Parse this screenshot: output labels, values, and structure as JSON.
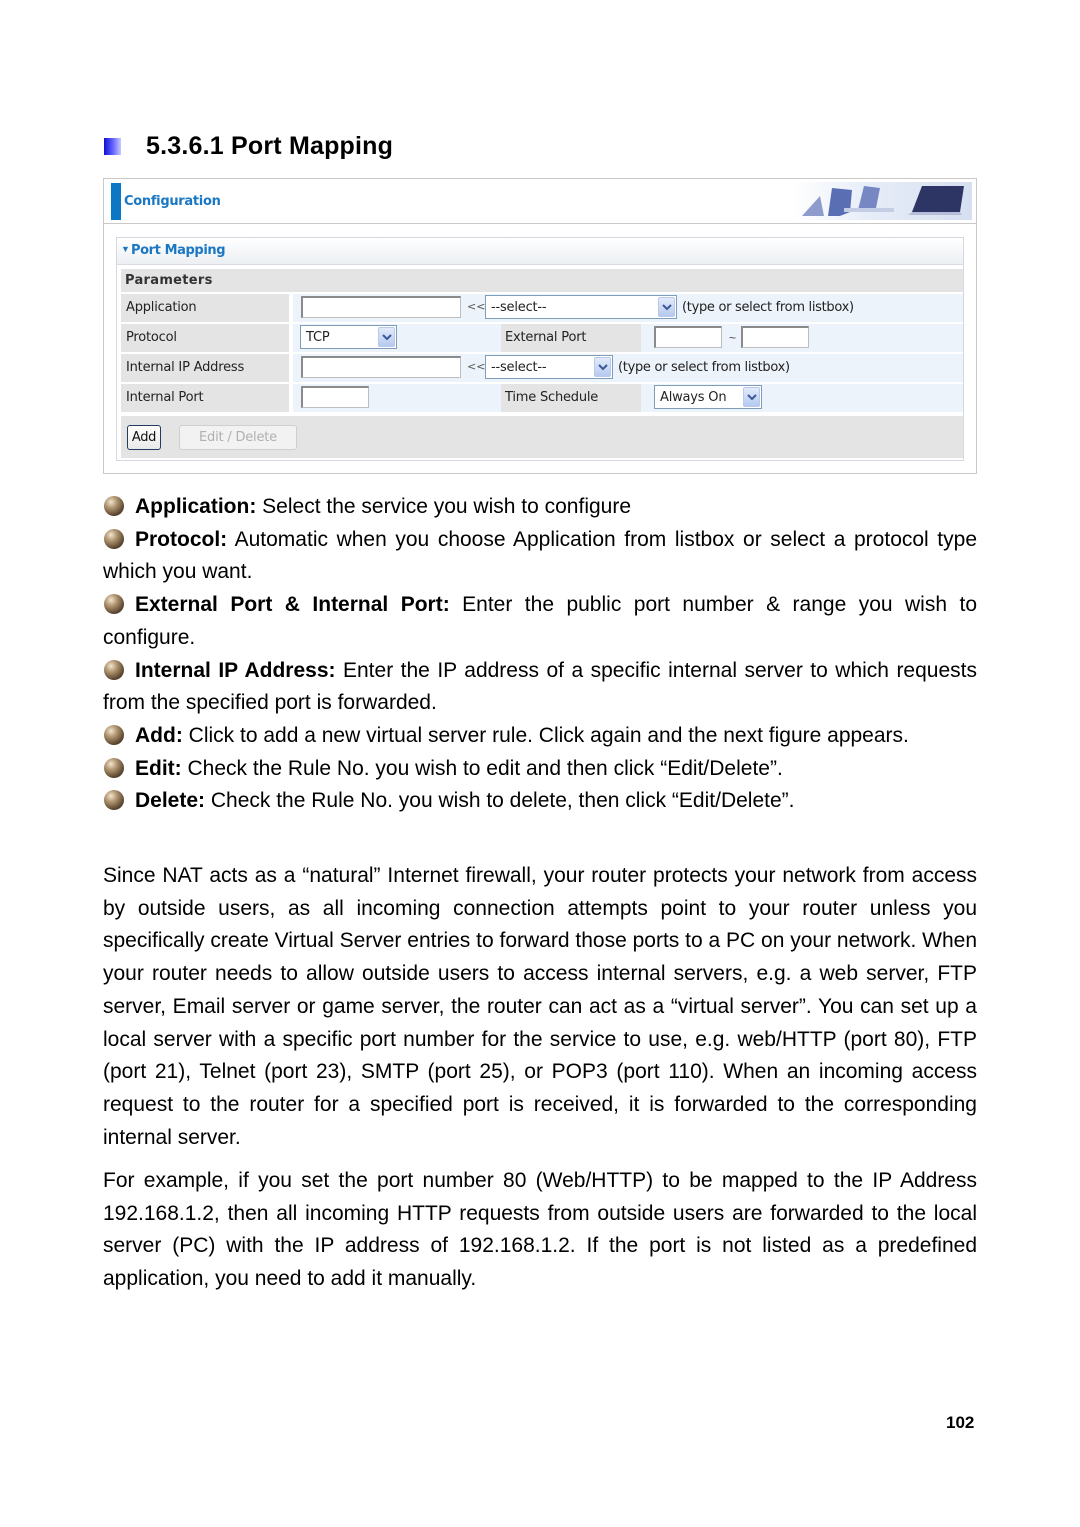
{
  "heading": {
    "text": "5.3.6.1 Port Mapping"
  },
  "panel": {
    "header_title": "Configuration",
    "header_image": "office-chairs-monitor-banner",
    "section_title": "Port Mapping",
    "parameters_label": "Parameters",
    "rows": {
      "application": {
        "label": "Application",
        "value": "",
        "arrows": "<<",
        "select_value": "--select--",
        "hint": "(type or select from listbox)"
      },
      "protocol": {
        "label": "Protocol",
        "select_value": "TCP",
        "external_port_label": "External Port",
        "external_port_from": "",
        "tilde": "~",
        "external_port_to": ""
      },
      "internal_ip": {
        "label": "Internal IP Address",
        "value": "",
        "arrows": "<<",
        "select_value": "--select--",
        "hint": "(type or select from listbox)"
      },
      "internal_port": {
        "label": "Internal Port",
        "value": "",
        "time_schedule_label": "Time Schedule",
        "time_schedule_value": "Always On"
      }
    },
    "buttons": {
      "add": "Add",
      "edit_delete": "Edit / Delete"
    }
  },
  "bullets": [
    {
      "term": "Application:",
      "text": " Select the service you wish to configure"
    },
    {
      "term": "Protocol:",
      "text": " Automatic when you choose Application from listbox or select a protocol type which you want."
    },
    {
      "term": "External Port & Internal Port:",
      "text": " Enter the public port number & range you wish to configure."
    },
    {
      "term": "Internal IP Address:",
      "text": " Enter the IP address of a specific internal server to which requests from the specified port is forwarded."
    },
    {
      "term": "Add:",
      "text": " Click to add a new virtual server rule. Click again and the next figure appears."
    },
    {
      "term": "Edit:",
      "text": " Check the Rule No. you wish to edit and then click “Edit/Delete”."
    },
    {
      "term": "Delete:",
      "text": " Check the Rule No. you wish to delete, then click “Edit/Delete”."
    }
  ],
  "paragraphs": [
    "Since NAT acts as a “natural” Internet firewall, your router protects your network from access by outside users, as all incoming connection attempts point to your router unless you specifically create Virtual Server entries to forward those ports to a PC on your network. When your router needs to allow outside users to access internal servers, e.g. a web server, FTP server, Email server or game server, the router can act as a “virtual server”. You can set up a local server with a specific port number for the service to use, e.g. web/HTTP (port 80), FTP (port 21), Telnet (port 23), SMTP (port 25), or POP3 (port 110). When an incoming access request to the router for a specified port is received, it is forwarded to the corresponding internal server.",
    "For example, if you set the port number 80 (Web/HTTP) to be mapped to the IP Address 192.168.1.2, then all incoming HTTP requests from outside users are forwarded to the local server (PC) with the IP address of 192.168.1.2. If the port is not listed as a predefined application, you need to add it manually."
  ],
  "page_number": "102",
  "colors": {
    "accent_blue": "#1a77c4",
    "label_bg": "#e4e4e4",
    "value_bg": "#edf3fb"
  }
}
